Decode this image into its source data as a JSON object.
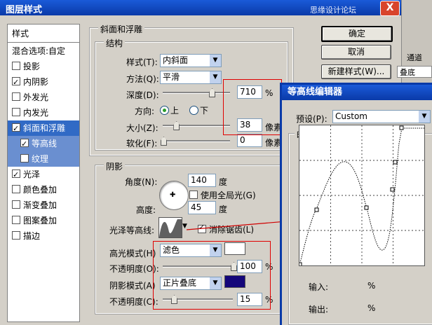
{
  "window": {
    "title": "图层样式",
    "watermark": "思缘设计论坛",
    "close": "X"
  },
  "styles_panel": {
    "header": "样式",
    "items": [
      {
        "label": "混合选项:自定",
        "checkbox": false,
        "checked": false,
        "state": "normal"
      },
      {
        "label": "投影",
        "checkbox": true,
        "checked": false,
        "state": "normal"
      },
      {
        "label": "内阴影",
        "checkbox": true,
        "checked": true,
        "state": "normal"
      },
      {
        "label": "外发光",
        "checkbox": true,
        "checked": false,
        "state": "normal"
      },
      {
        "label": "内发光",
        "checkbox": true,
        "checked": false,
        "state": "normal"
      },
      {
        "label": "斜面和浮雕",
        "checkbox": true,
        "checked": true,
        "state": "selected"
      },
      {
        "label": "等高线",
        "checkbox": true,
        "checked": true,
        "state": "sub"
      },
      {
        "label": "纹理",
        "checkbox": true,
        "checked": false,
        "state": "sub"
      },
      {
        "label": "光泽",
        "checkbox": true,
        "checked": true,
        "state": "normal"
      },
      {
        "label": "颜色叠加",
        "checkbox": true,
        "checked": false,
        "state": "normal"
      },
      {
        "label": "渐变叠加",
        "checkbox": true,
        "checked": false,
        "state": "normal"
      },
      {
        "label": "图案叠加",
        "checkbox": true,
        "checked": false,
        "state": "normal"
      },
      {
        "label": "描边",
        "checkbox": true,
        "checked": false,
        "state": "normal"
      }
    ]
  },
  "bevel": {
    "group_title": "斜面和浮雕",
    "structure_title": "结构",
    "style_label": "样式(T):",
    "style_value": "内斜面",
    "method_label": "方法(Q):",
    "method_value": "平滑",
    "depth_label": "深度(D):",
    "depth_value": "710",
    "depth_unit": "%",
    "depth_level": 0.72,
    "direction_label": "方向:",
    "dir_up": "上",
    "dir_down": "下",
    "size_label": "大小(Z):",
    "size_value": "38",
    "size_unit": "像素",
    "size_level": 0.19,
    "soften_label": "软化(F):",
    "soften_value": "0",
    "soften_unit": "像素",
    "soften_level": 0.0
  },
  "shading": {
    "title": "阴影",
    "angle_label": "角度(N):",
    "angle_value": "140",
    "angle_unit": "度",
    "global_light": "使用全局光(G)",
    "altitude_label": "高度:",
    "altitude_value": "45",
    "altitude_unit": "度",
    "gloss_label": "光泽等高线:",
    "antialias": "消除锯齿(L)",
    "highlight_label": "高光模式(H)",
    "highlight_mode": "滤色",
    "highlight_color": "#ffffff",
    "opacity1_label": "不透明度(O):",
    "opacity1_value": "100",
    "opacity1_unit": "%",
    "opacity1_level": 1.0,
    "shadow_label": "阴影模式(A)",
    "shadow_mode": "正片叠底",
    "shadow_color": "#14067a",
    "opacity2_label": "不透明度(C):",
    "opacity2_value": "15",
    "opacity2_unit": "%",
    "opacity2_level": 0.15
  },
  "buttons": {
    "ok": "确定",
    "cancel": "取消",
    "new_style": "新建样式(W)..."
  },
  "bg_fragments": {
    "tab": "通道",
    "dropdown": "叠底"
  },
  "contour_editor": {
    "title": "等高线编辑器",
    "preset_label": "预设(P):",
    "preset_value": "Custom",
    "mapping_title": "映射",
    "input_label": "输入:",
    "input_unit": "%",
    "output_label": "输出:",
    "output_unit": "%"
  }
}
